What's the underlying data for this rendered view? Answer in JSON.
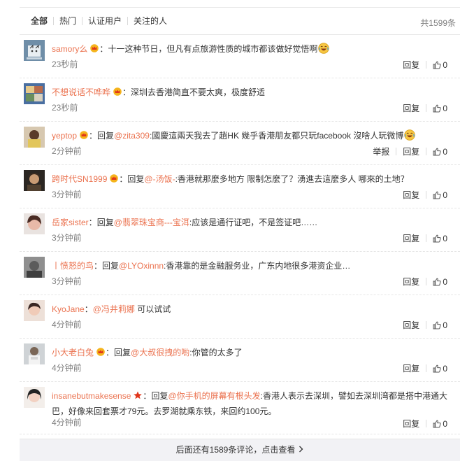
{
  "tabs": [
    {
      "label": "全部"
    },
    {
      "label": "热门"
    },
    {
      "label": "认证用户"
    },
    {
      "label": "关注的人"
    }
  ],
  "total": "共1599条",
  "reply_label": "回复",
  "report_label": "举报",
  "reply_prefix": "回复",
  "comments": [
    {
      "user": "samory么",
      "sep": "：",
      "text": "十一这种节日，但凡有点旅游性质的城市都该做好觉悟啊",
      "time": "23秒前",
      "likes": "0",
      "badge": "crown-icon",
      "emoji": "laugh-emoji"
    },
    {
      "user": "不想说话不哗哗",
      "sep": "：",
      "text": "深圳去香港简直不要太爽，极度舒适",
      "time": "23秒前",
      "likes": "0",
      "badge": "crown-icon"
    },
    {
      "user": "yeptop",
      "sep": "：",
      "reply_to": "@zita309",
      "text": ":國慶這兩天我去了趟HK 幾乎香港朋友都只玩facebook 沒啥人玩微博",
      "time": "2分钟前",
      "likes": "0",
      "badge": "crown-icon",
      "emoji": "laugh-emoji",
      "report": true
    },
    {
      "user": "跨时代SN1999",
      "sep": "：",
      "reply_to": "@-汤饭-",
      "text": ":香港就那麼多地方 限制怎麼了？湧進去這麼多人 哪來的土地？",
      "time": "3分钟前",
      "likes": "0",
      "badge": "crown-icon"
    },
    {
      "user": "岳家sister",
      "sep": "：",
      "reply_to": "@翡翠珠宝商---宝洱",
      "text": ":应该是通行证吧，不是签证吧……",
      "time": "3分钟前",
      "likes": "0"
    },
    {
      "user": "丨愤怒的鸟",
      "sep": "：",
      "reply_to": "@LYOxinnn",
      "text": ":香港靠的是金融服务业，广东内地很多港资企业…",
      "time": "3分钟前",
      "likes": "0"
    },
    {
      "user": "KyoJane",
      "sep": "：",
      "reply_to_plain": "@冯井莉娜",
      "text": " 可以试试",
      "time": "4分钟前",
      "likes": "0"
    },
    {
      "user": "小大老白兔",
      "sep": "：",
      "reply_to": "@大叔很拽的喲",
      "text": ":你管的太多了",
      "time": "4分钟前",
      "likes": "0",
      "badge": "crown-icon"
    },
    {
      "user": "insanebutmakesense",
      "sep": "：",
      "reply_to": "@你手机的屏幕有根头发",
      "text": ":香港人表示去深圳，譬如去深圳湾都是搭中港通大巴，好像来回套票才79元。去罗湖就乘东铁，来回约100元。",
      "time": "4分钟前",
      "likes": "0",
      "badge": "star-icon"
    }
  ],
  "more_text": "后面还有1589条评论，点击查看",
  "colors": {
    "link": "#eb7350",
    "muted": "#808080",
    "footer_bg": "#f2f2f5"
  }
}
